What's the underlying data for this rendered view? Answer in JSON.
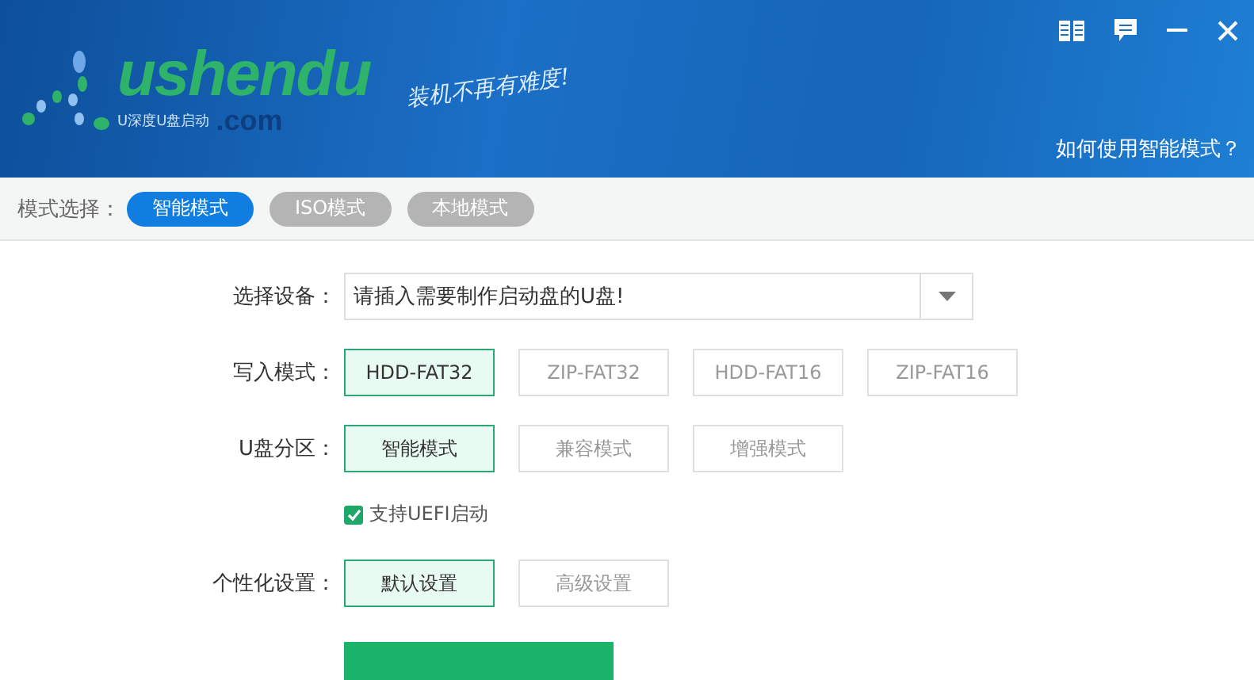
{
  "header": {
    "logo_text": "ushendu",
    "logo_subtitle": "U深度U盘启动",
    "logo_domain": ".com",
    "slogan": "装机不再有难度!",
    "help_link": "如何使用智能模式？"
  },
  "mode_bar": {
    "label": "模式选择：",
    "modes": [
      {
        "label": "智能模式",
        "selected": true
      },
      {
        "label": "ISO模式",
        "selected": false
      },
      {
        "label": "本地模式",
        "selected": false
      }
    ]
  },
  "device": {
    "label": "选择设备：",
    "value": "请插入需要制作启动盘的U盘!"
  },
  "write_mode": {
    "label": "写入模式：",
    "options": [
      {
        "label": "HDD-FAT32",
        "selected": true
      },
      {
        "label": "ZIP-FAT32",
        "selected": false
      },
      {
        "label": "HDD-FAT16",
        "selected": false
      },
      {
        "label": "ZIP-FAT16",
        "selected": false
      }
    ]
  },
  "partition": {
    "label": "U盘分区：",
    "options": [
      {
        "label": "智能模式",
        "selected": true
      },
      {
        "label": "兼容模式",
        "selected": false
      },
      {
        "label": "增强模式",
        "selected": false
      }
    ]
  },
  "uefi": {
    "label": "支持UEFI启动",
    "checked": true
  },
  "personalize": {
    "label": "个性化设置：",
    "options": [
      {
        "label": "默认设置",
        "selected": true
      },
      {
        "label": "高级设置",
        "selected": false
      }
    ]
  }
}
